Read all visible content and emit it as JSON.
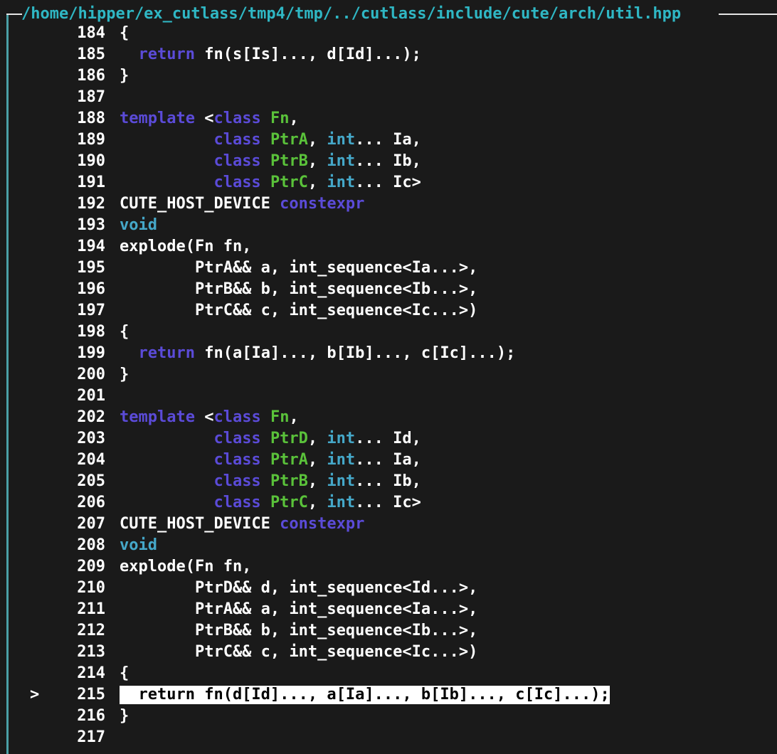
{
  "window": {
    "title": "/home/hipper/ex_cutlass/tmp4/tmp/../cutlass/include/cute/arch/util.hpp"
  },
  "theme": {
    "background": "#1a1a1a",
    "border": "#4aa0a6",
    "title_color": "#2fb7c4",
    "keyword_color": "#5b4bd8",
    "type_color": "#45a8c9",
    "identifier_color": "#5ac23a",
    "text_color": "#ffffff",
    "highlight_bg": "#ffffff"
  },
  "source": {
    "current_line": "215",
    "marker_symbol": ">",
    "lines": [
      {
        "number": "184",
        "tokens": [
          {
            "t": "{",
            "c": "tx"
          }
        ]
      },
      {
        "number": "185",
        "tokens": [
          {
            "t": "  ",
            "c": "tx"
          },
          {
            "t": "return",
            "c": "kw"
          },
          {
            "t": " fn(s[Is]..., d[Id]...);",
            "c": "tx"
          }
        ]
      },
      {
        "number": "186",
        "tokens": [
          {
            "t": "}",
            "c": "tx"
          }
        ]
      },
      {
        "number": "187",
        "tokens": []
      },
      {
        "number": "188",
        "tokens": [
          {
            "t": "template",
            "c": "kw"
          },
          {
            "t": " <",
            "c": "tx"
          },
          {
            "t": "class",
            "c": "kw"
          },
          {
            "t": " ",
            "c": "tx"
          },
          {
            "t": "Fn",
            "c": "id"
          },
          {
            "t": ",",
            "c": "tx"
          }
        ]
      },
      {
        "number": "189",
        "tokens": [
          {
            "t": "          ",
            "c": "tx"
          },
          {
            "t": "class",
            "c": "kw"
          },
          {
            "t": " ",
            "c": "tx"
          },
          {
            "t": "PtrA",
            "c": "id"
          },
          {
            "t": ", ",
            "c": "tx"
          },
          {
            "t": "int",
            "c": "ty"
          },
          {
            "t": "... Ia,",
            "c": "tx"
          }
        ]
      },
      {
        "number": "190",
        "tokens": [
          {
            "t": "          ",
            "c": "tx"
          },
          {
            "t": "class",
            "c": "kw"
          },
          {
            "t": " ",
            "c": "tx"
          },
          {
            "t": "PtrB",
            "c": "id"
          },
          {
            "t": ", ",
            "c": "tx"
          },
          {
            "t": "int",
            "c": "ty"
          },
          {
            "t": "... Ib,",
            "c": "tx"
          }
        ]
      },
      {
        "number": "191",
        "tokens": [
          {
            "t": "          ",
            "c": "tx"
          },
          {
            "t": "class",
            "c": "kw"
          },
          {
            "t": " ",
            "c": "tx"
          },
          {
            "t": "PtrC",
            "c": "id"
          },
          {
            "t": ", ",
            "c": "tx"
          },
          {
            "t": "int",
            "c": "ty"
          },
          {
            "t": "... Ic>",
            "c": "tx"
          }
        ]
      },
      {
        "number": "192",
        "tokens": [
          {
            "t": "CUTE_HOST_DEVICE ",
            "c": "tx"
          },
          {
            "t": "constexpr",
            "c": "kw"
          }
        ]
      },
      {
        "number": "193",
        "tokens": [
          {
            "t": "void",
            "c": "ty"
          }
        ]
      },
      {
        "number": "194",
        "tokens": [
          {
            "t": "explode(Fn fn,",
            "c": "tx"
          }
        ]
      },
      {
        "number": "195",
        "tokens": [
          {
            "t": "        PtrA&& a, int_sequence<Ia...>,",
            "c": "tx"
          }
        ]
      },
      {
        "number": "196",
        "tokens": [
          {
            "t": "        PtrB&& b, int_sequence<Ib...>,",
            "c": "tx"
          }
        ]
      },
      {
        "number": "197",
        "tokens": [
          {
            "t": "        PtrC&& c, int_sequence<Ic...>)",
            "c": "tx"
          }
        ]
      },
      {
        "number": "198",
        "tokens": [
          {
            "t": "{",
            "c": "tx"
          }
        ]
      },
      {
        "number": "199",
        "tokens": [
          {
            "t": "  ",
            "c": "tx"
          },
          {
            "t": "return",
            "c": "kw"
          },
          {
            "t": " fn(a[Ia]..., b[Ib]..., c[Ic]...);",
            "c": "tx"
          }
        ]
      },
      {
        "number": "200",
        "tokens": [
          {
            "t": "}",
            "c": "tx"
          }
        ]
      },
      {
        "number": "201",
        "tokens": []
      },
      {
        "number": "202",
        "tokens": [
          {
            "t": "template",
            "c": "kw"
          },
          {
            "t": " <",
            "c": "tx"
          },
          {
            "t": "class",
            "c": "kw"
          },
          {
            "t": " ",
            "c": "tx"
          },
          {
            "t": "Fn",
            "c": "id"
          },
          {
            "t": ",",
            "c": "tx"
          }
        ]
      },
      {
        "number": "203",
        "tokens": [
          {
            "t": "          ",
            "c": "tx"
          },
          {
            "t": "class",
            "c": "kw"
          },
          {
            "t": " ",
            "c": "tx"
          },
          {
            "t": "PtrD",
            "c": "id"
          },
          {
            "t": ", ",
            "c": "tx"
          },
          {
            "t": "int",
            "c": "ty"
          },
          {
            "t": "... Id,",
            "c": "tx"
          }
        ]
      },
      {
        "number": "204",
        "tokens": [
          {
            "t": "          ",
            "c": "tx"
          },
          {
            "t": "class",
            "c": "kw"
          },
          {
            "t": " ",
            "c": "tx"
          },
          {
            "t": "PtrA",
            "c": "id"
          },
          {
            "t": ", ",
            "c": "tx"
          },
          {
            "t": "int",
            "c": "ty"
          },
          {
            "t": "... Ia,",
            "c": "tx"
          }
        ]
      },
      {
        "number": "205",
        "tokens": [
          {
            "t": "          ",
            "c": "tx"
          },
          {
            "t": "class",
            "c": "kw"
          },
          {
            "t": " ",
            "c": "tx"
          },
          {
            "t": "PtrB",
            "c": "id"
          },
          {
            "t": ", ",
            "c": "tx"
          },
          {
            "t": "int",
            "c": "ty"
          },
          {
            "t": "... Ib,",
            "c": "tx"
          }
        ]
      },
      {
        "number": "206",
        "tokens": [
          {
            "t": "          ",
            "c": "tx"
          },
          {
            "t": "class",
            "c": "kw"
          },
          {
            "t": " ",
            "c": "tx"
          },
          {
            "t": "PtrC",
            "c": "id"
          },
          {
            "t": ", ",
            "c": "tx"
          },
          {
            "t": "int",
            "c": "ty"
          },
          {
            "t": "... Ic>",
            "c": "tx"
          }
        ]
      },
      {
        "number": "207",
        "tokens": [
          {
            "t": "CUTE_HOST_DEVICE ",
            "c": "tx"
          },
          {
            "t": "constexpr",
            "c": "kw"
          }
        ]
      },
      {
        "number": "208",
        "tokens": [
          {
            "t": "void",
            "c": "ty"
          }
        ]
      },
      {
        "number": "209",
        "tokens": [
          {
            "t": "explode(Fn fn,",
            "c": "tx"
          }
        ]
      },
      {
        "number": "210",
        "tokens": [
          {
            "t": "        PtrD&& d, int_sequence<Id...>,",
            "c": "tx"
          }
        ]
      },
      {
        "number": "211",
        "tokens": [
          {
            "t": "        PtrA&& a, int_sequence<Ia...>,",
            "c": "tx"
          }
        ]
      },
      {
        "number": "212",
        "tokens": [
          {
            "t": "        PtrB&& b, int_sequence<Ib...>,",
            "c": "tx"
          }
        ]
      },
      {
        "number": "213",
        "tokens": [
          {
            "t": "        PtrC&& c, int_sequence<Ic...>)",
            "c": "tx"
          }
        ]
      },
      {
        "number": "214",
        "tokens": [
          {
            "t": "{",
            "c": "tx"
          }
        ]
      },
      {
        "number": "215",
        "tokens": [
          {
            "t": "  return fn(d[Id]..., a[Ia]..., b[Ib]..., c[Ic]...);",
            "c": "tx"
          }
        ]
      },
      {
        "number": "216",
        "tokens": [
          {
            "t": "}",
            "c": "tx"
          }
        ]
      },
      {
        "number": "217",
        "tokens": []
      }
    ]
  }
}
